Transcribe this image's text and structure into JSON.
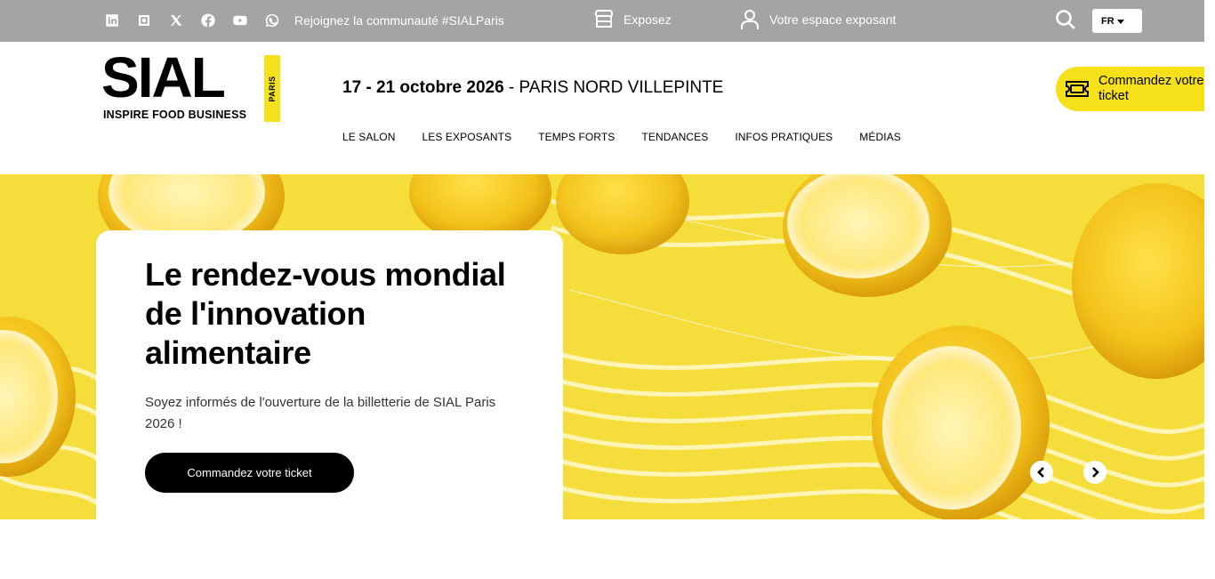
{
  "topbar": {
    "social_icons": [
      "linkedin-icon",
      "instagram-icon",
      "x-icon",
      "facebook-icon",
      "youtube-icon",
      "whatsapp-icon"
    ],
    "community_text": "Rejoignez la communauté #SIALParis",
    "exposez_label": "Exposez",
    "espace_label": "Votre espace exposant",
    "lang_label": "FR"
  },
  "header": {
    "logo_text": "SIAL",
    "logo_tagline": "INSPIRE FOOD BUSINESS",
    "logo_city": "PARIS",
    "dates_bold": "17 - 21 octobre 2026",
    "dates_rest": " - PARIS NORD VILLEPINTE",
    "nav": [
      "LE SALON",
      "LES EXPOSANTS",
      "TEMPS FORTS",
      "TENDANCES",
      "INFOS PRATIQUES",
      "MÉDIAS"
    ],
    "ticket_label": "Commandez votre ticket"
  },
  "hero": {
    "title": "Le rendez-vous mondial de l'innovation alimentaire",
    "text": "Soyez informés de l'ouverture de la billetterie de SIAL Paris 2026 !",
    "button_label": "Commandez votre ticket"
  },
  "colors": {
    "topbar": "#a4a4a4",
    "accent_yellow": "#f6e01a",
    "hero_bg": "#f5dc3a"
  }
}
